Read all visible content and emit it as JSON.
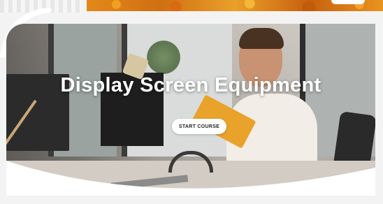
{
  "hero": {
    "title": "Display Screen Equipment",
    "cta_label": "START COURSE"
  },
  "colors": {
    "accent_orange": "#e3891a",
    "title_text": "#ffffff",
    "button_bg": "#ffffff"
  },
  "icons": {
    "header_strip": "orange-texture-banner"
  }
}
